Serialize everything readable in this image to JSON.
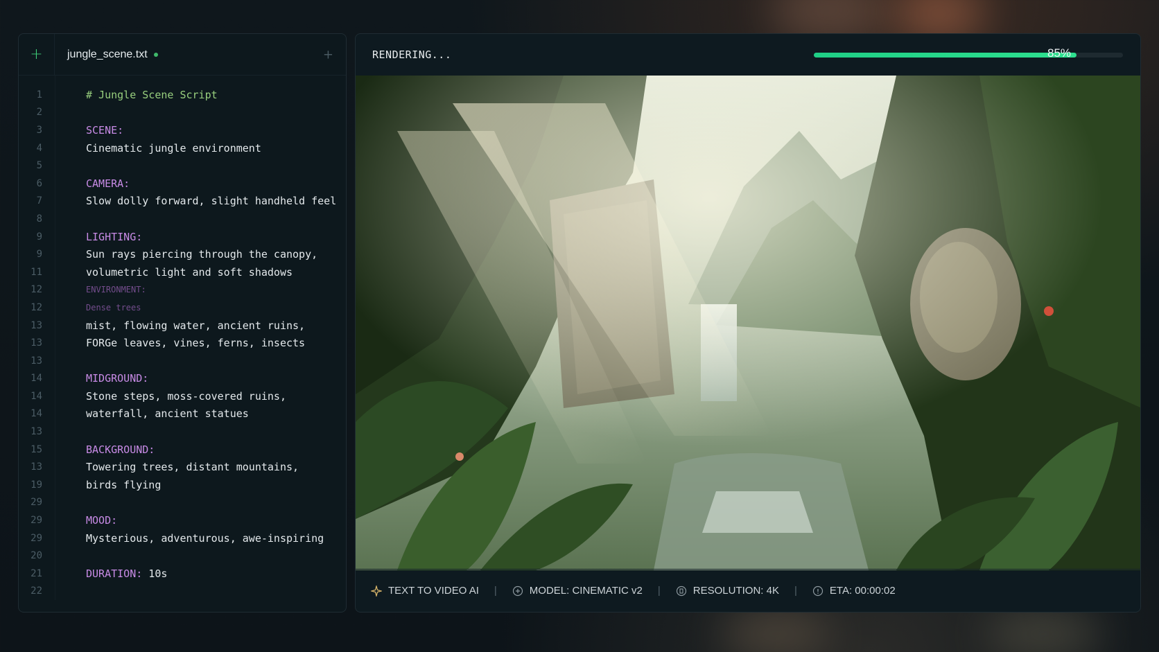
{
  "editor": {
    "tab_name": "jungle_scene.txt",
    "lines": [
      {
        "n": "1",
        "text": "# Jungle Scene Script",
        "kind": "comment"
      },
      {
        "n": "2",
        "text": "",
        "kind": "plain"
      },
      {
        "n": "3",
        "text": "SCENE:",
        "kind": "key"
      },
      {
        "n": "4",
        "text": "Cinematic jungle environment",
        "kind": "plain"
      },
      {
        "n": "5",
        "text": "",
        "kind": "plain"
      },
      {
        "n": "6",
        "text": "CAMERA:",
        "kind": "key"
      },
      {
        "n": "7",
        "text": "Slow dolly forward, slight handheld feel",
        "kind": "plain"
      },
      {
        "n": "8",
        "text": "",
        "kind": "plain"
      },
      {
        "n": "9",
        "text": "LIGHTING:",
        "kind": "key"
      },
      {
        "n": "9",
        "text": "Sun rays piercing through the canopy,",
        "kind": "plain"
      },
      {
        "n": "11",
        "text": "volumetric light and soft shadows",
        "kind": "plain"
      },
      {
        "n": "12",
        "text": "ENVIRONMENT:",
        "kind": "ghost"
      },
      {
        "n": "12",
        "text": "Dense trees",
        "kind": "ghost"
      },
      {
        "n": "13",
        "text": "mist, flowing water, ancient ruins,",
        "kind": "plain"
      },
      {
        "n": "13",
        "text": "FORGe leaves, vines, ferns, insects",
        "kind": "plain"
      },
      {
        "n": "13",
        "text": "",
        "kind": "plain"
      },
      {
        "n": "14",
        "text": "MIDGROUND:",
        "kind": "key"
      },
      {
        "n": "14",
        "text": "Stone steps, moss-covered ruins,",
        "kind": "plain"
      },
      {
        "n": "14",
        "text": "waterfall, ancient statues",
        "kind": "plain"
      },
      {
        "n": "13",
        "text": "",
        "kind": "plain"
      },
      {
        "n": "15",
        "text": "BACKGROUND:",
        "kind": "key"
      },
      {
        "n": "13",
        "text": "Towering trees, distant mountains,",
        "kind": "plain"
      },
      {
        "n": "19",
        "text": "birds flying",
        "kind": "plain"
      },
      {
        "n": "29",
        "text": "",
        "kind": "plain"
      },
      {
        "n": "29",
        "text": "MOOD:",
        "kind": "key"
      },
      {
        "n": "29",
        "text": "Mysterious, adventurous, awe-inspiring",
        "kind": "plain"
      },
      {
        "n": "20",
        "text": "",
        "kind": "plain"
      },
      {
        "n": "21",
        "text": "DURATION: 10s",
        "kind": "mixed",
        "key": "DURATION:",
        "value": " 10s"
      },
      {
        "n": "22",
        "text": "",
        "kind": "plain"
      }
    ]
  },
  "render": {
    "status": "RENDERING...",
    "progress": 0.85,
    "progress_label": "85%",
    "footer": {
      "product": "TEXT TO VIDEO AI",
      "model": "MODEL: CINEMATIC v2",
      "resolution": "RESOLUTION: 4K",
      "eta": "ETA: 00:00:02"
    }
  },
  "colors": {
    "accent": "#2ee08f",
    "keyword": "#c88be6",
    "comment": "#98cf7e"
  }
}
